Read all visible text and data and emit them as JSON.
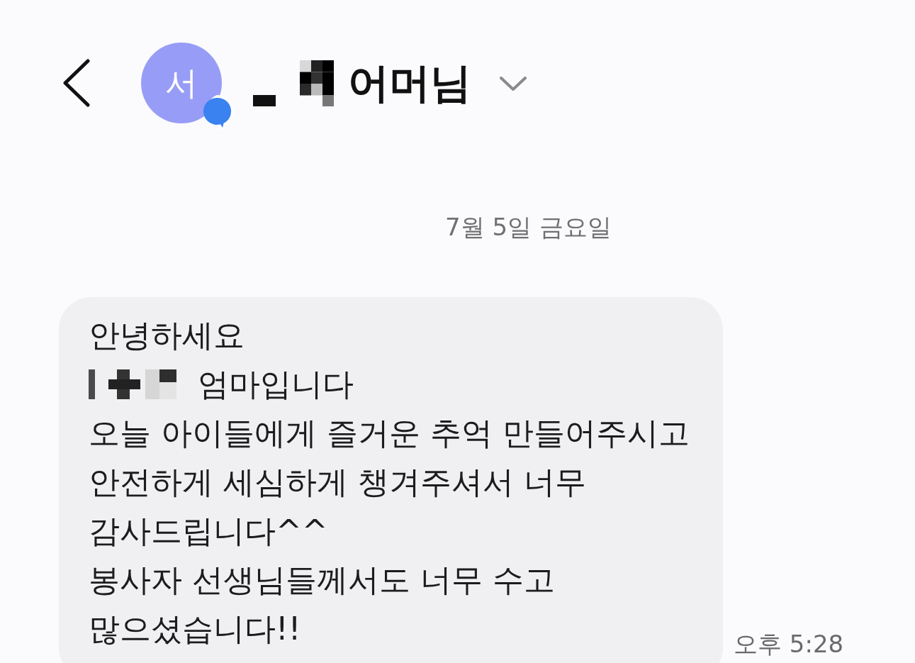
{
  "header": {
    "avatar_initial": "서",
    "name_redacted": true,
    "name": "어머님"
  },
  "date_divider": "7월 5일 금요일",
  "message": {
    "lines": [
      {
        "text": "안녕하세요",
        "redacted_prefix": false
      },
      {
        "text": "엄마입니다",
        "redacted_prefix": true
      },
      {
        "text": "오늘 아이들에게 즐거운 추억 만들어주시고",
        "redacted_prefix": false
      },
      {
        "text": "안전하게 세심하게 챙겨주셔서 너무",
        "redacted_prefix": false
      },
      {
        "text": "감사드립니다^^",
        "redacted_prefix": false
      },
      {
        "text": "봉사자 선생님들께서도 너무 수고",
        "redacted_prefix": false
      },
      {
        "text": "많으셨습니다!!",
        "redacted_prefix": false
      }
    ],
    "time": "오후 5:28"
  }
}
